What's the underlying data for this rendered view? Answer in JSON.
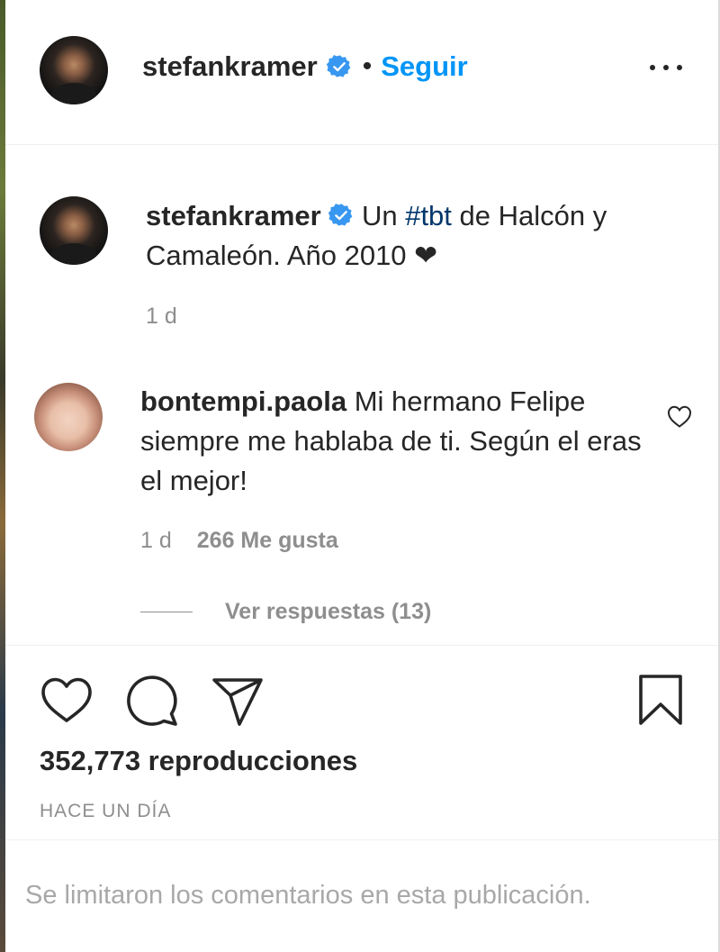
{
  "header": {
    "username": "stefankramer",
    "separator": "•",
    "follow_label": "Seguir"
  },
  "caption": {
    "username": "stefankramer",
    "text_before": " Un ",
    "hashtag": "#tbt",
    "text_after": " de Halcón y Camaleón. Año 2010 ❤",
    "time": "1 d"
  },
  "comment": {
    "username": "bontempi.paola",
    "text": " Mi hermano Felipe siempre me hablaba de ti. Según el eras el mejor!",
    "time": "1 d",
    "likes": "266 Me gusta",
    "view_replies": "Ver respuestas (13)"
  },
  "stats": {
    "views": "352,773 reproducciones",
    "posted": "HACE UN DÍA"
  },
  "footer": {
    "comments_limited": "Se limitaron los comentarios en esta publicación."
  },
  "colors": {
    "accent": "#0095f6",
    "hashtag": "#00376b",
    "verified": "#3897f0",
    "muted": "#8e8e8e"
  },
  "icons": [
    "verified-badge-icon",
    "more-options-icon",
    "heart-icon",
    "comment-icon",
    "share-icon",
    "bookmark-icon"
  ]
}
